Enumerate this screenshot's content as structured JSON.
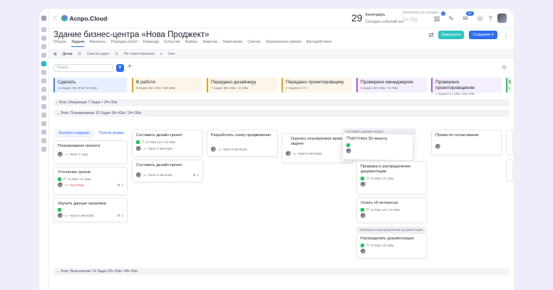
{
  "app": {
    "name": "Аспро.Cloud"
  },
  "calendar": {
    "day": "29",
    "label": "Календарь",
    "sub": "Сегодня событий нет"
  },
  "record": {
    "label": "Затрачено за сегодня",
    "value": "0ч 0м"
  },
  "badges": {
    "tasks": "1",
    "chat": "99+"
  },
  "project": {
    "title": "Здание бизнес-центра «Нова Проджект»",
    "finish_label": "Завершить",
    "create_label": "Создание"
  },
  "tabs": [
    "Общее",
    "Задачи",
    "Финансы",
    "Порядок работ",
    "Команда",
    "События",
    "Файлы",
    "Заметки",
    "Замечания",
    "Списки",
    "Затраченное время",
    "Автодействия"
  ],
  "views": [
    "Доска",
    "Список задач",
    "По ответственным",
    "Гант"
  ],
  "search": {
    "placeholder": "Поиск"
  },
  "columns": [
    {
      "title": "Сделать",
      "stats": "14 Задач  36ч 00м / 6ч 00м",
      "color": "#3b82f6",
      "bg": "#e8efff"
    },
    {
      "title": "В работе",
      "stats": "8 Задач  55ч 27м / 36ч 00м",
      "color": "#f59e0b",
      "bg": "#fdf6e8"
    },
    {
      "title": "Передано дизайнеру",
      "stats": "7 Задач  36ч 00м / 1ч 00м",
      "color": "#f59e0b",
      "bg": "#fdf6e8"
    },
    {
      "title": "Передано проектировщику",
      "stats": "2 Задачи  0 / 0",
      "color": "#f59e0b",
      "bg": "#fdf6e8"
    },
    {
      "title": "Проверено менеджером",
      "stats": "8 Задач  36ч 00м / 3ч 00м",
      "color": "#a855f7",
      "bg": "#f5eefc"
    },
    {
      "title": "Проверено проектировщиком",
      "stats": "1 Задача  4ч 00м / 36ч 00м",
      "color": "#a855f7",
      "bg": "#f5eefc"
    },
    {
      "title": "З",
      "stats": "5",
      "color": "#22c55e",
      "bg": "#e9f8ef"
    }
  ],
  "stages": {
    "init": "Этап: Инициация  7 Задач  / 24ч 00м",
    "plan": "Этап: Планирование  15 Задач  36ч 42м / 24ч 00м",
    "exec": "Этап: Выполнение  14 Задач  92ч 50м / 44ч 00м"
  },
  "quick": {
    "quick": "Быстрое создание",
    "full": "Полная форма"
  },
  "cards": {
    "c1": {
      "title": "Планирование проекта",
      "due": "через 2 года"
    },
    "c2": {
      "title": "Уточнение сроков",
      "time": "0ч 00м / 0ч 00м",
      "due": "год назад",
      "count": "1"
    },
    "c3": {
      "title": "Изучить данные заказчика",
      "due": "через 5 месяцев",
      "count": "1"
    },
    "c4": {
      "title": "Составить дизайн-проект",
      "time": "3ч 00м 12с / 6ч 00м",
      "due": "через 5 месяцев"
    },
    "c5": {
      "title": "Составить дизайн-проект",
      "due": "через 8 месяцев",
      "count": "1"
    },
    "c6": {
      "title": "Разработать схему продвижения",
      "due": "через 8 месяцев"
    },
    "c7": {
      "title": "Оценить планируемое время задачи",
      "due": "через 6 месяцев"
    },
    "c8": {
      "title": "Подготовка 3D-макета",
      "group": "Составить дизайн-проект"
    },
    "c9": {
      "title": "Проверка и распределение документации",
      "time": "0ч 00м / 0ч 00м"
    },
    "c10": {
      "title": "Узнать об интересах",
      "time": "0ч 00м 12с / 0ч 00м"
    },
    "c11": {
      "title": "Распределить документацию",
      "time": "0ч 00м / 0ч 00м",
      "group": "Проверка и распределение документации"
    },
    "c12": {
      "title": "Провести согласование"
    }
  }
}
